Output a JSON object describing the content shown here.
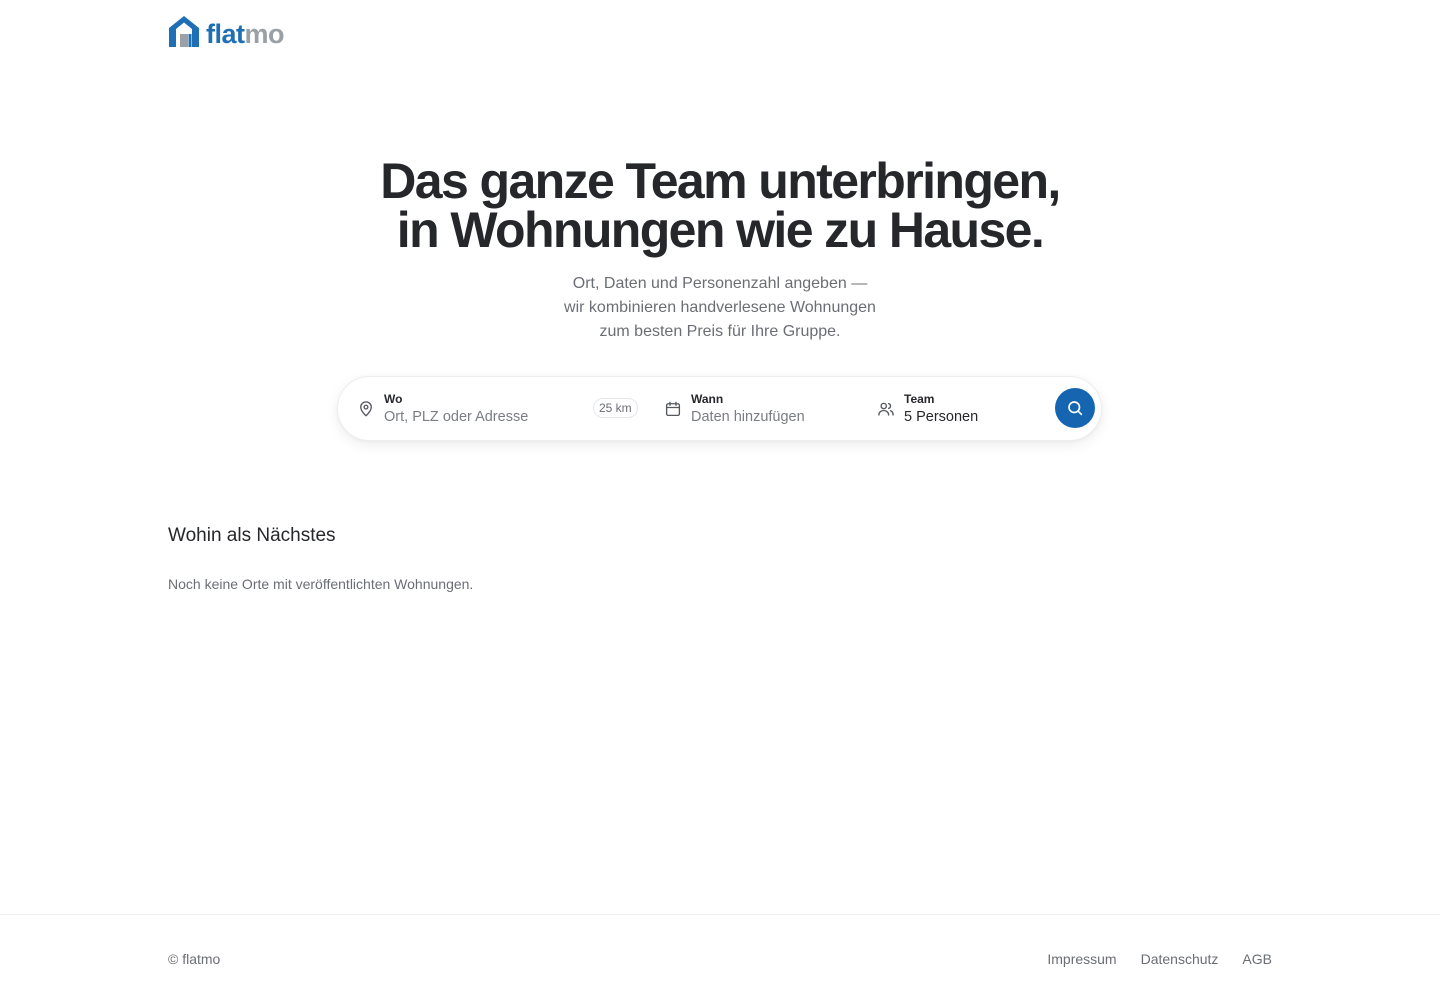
{
  "brand": {
    "name_part1": "flat",
    "name_part2": "mo",
    "colors": {
      "primary": "#1f6fb5",
      "secondary": "#9aa0a6",
      "accent_button": "#1565b1"
    }
  },
  "hero": {
    "title_line1": "Das ganze Team unterbringen,",
    "title_line2": "in Wohnungen wie zu Hause.",
    "subtitle_line1": "Ort, Daten und Personenzahl angeben —",
    "subtitle_line2": "wir kombinieren handverlesene Wohnungen",
    "subtitle_line3": "zum besten Preis für Ihre Gruppe."
  },
  "search": {
    "where": {
      "label": "Wo",
      "placeholder": "Ort, PLZ oder Adresse",
      "radius": "25 km",
      "icon": "map-pin-icon"
    },
    "when": {
      "label": "Wann",
      "placeholder": "Daten hinzufügen",
      "icon": "calendar-icon"
    },
    "team": {
      "label": "Team",
      "value": "5 Personen",
      "icon": "users-icon"
    },
    "button_icon": "search-icon"
  },
  "destinations": {
    "title": "Wohin als Nächstes",
    "empty_text": "Noch keine Orte mit veröffentlichten Wohnungen."
  },
  "footer": {
    "copyright": "© flatmo",
    "links": [
      "Impressum",
      "Datenschutz",
      "AGB"
    ]
  }
}
